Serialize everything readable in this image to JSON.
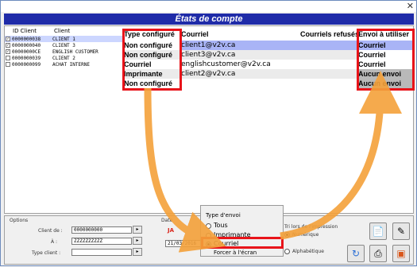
{
  "window": {
    "close_glyph": "✕",
    "title": "États de compte"
  },
  "client_list": {
    "columns": [
      "ID Client",
      "Client"
    ],
    "rows": [
      {
        "checked": true,
        "id": "0000000038",
        "name": "CLIENT 1",
        "selected": true
      },
      {
        "checked": true,
        "id": "0000000040",
        "name": "CLIENT 3",
        "selected": false
      },
      {
        "checked": true,
        "id": "00000000CE",
        "name": "ENGLISH CUSTOMER",
        "selected": false
      },
      {
        "checked": false,
        "id": "0000000039",
        "name": "CLIENT 2",
        "selected": false
      },
      {
        "checked": false,
        "id": "0000000099",
        "name": "ACHAT INTERNE",
        "selected": false
      }
    ]
  },
  "send_grid": {
    "headers": {
      "type": "Type configuré",
      "email": "Courriel",
      "refused": "Courriels refusés",
      "send": "Envoi à utiliser"
    },
    "rows": [
      {
        "type": "Non configuré",
        "email": "client1@v2v.ca",
        "send": "Courriel"
      },
      {
        "type": "Non configuré",
        "email": "client3@v2v.ca",
        "send": "Courriel"
      },
      {
        "type": "Courriel",
        "email": "englishcustomer@v2v.ca",
        "send": "Courriel"
      },
      {
        "type": "Imprimante",
        "email": "client2@v2v.ca",
        "send": "Aucun envoi"
      },
      {
        "type": "Non configuré",
        "email": "",
        "send": "Aucun envoi"
      }
    ]
  },
  "options": {
    "group_label": "Options",
    "client_from_label": "Client de :",
    "client_from_value": "0000000000",
    "client_to_label": "À :",
    "client_to_value": "ZZZZZZZZZZ",
    "client_type_label": "Type client :",
    "client_type_value": ""
  },
  "date": {
    "label": "Date",
    "value": "21/03/2016"
  },
  "send_type": {
    "title": "Type d'envoi",
    "options": [
      "Tous",
      "Imprimante",
      "Courriel"
    ],
    "selected": "Courriel",
    "force_label": "Forcer à l'écran"
  },
  "sort": {
    "title": "Tri lors de l'impression",
    "numeric": "Numérique",
    "alpha": "Alphabétique"
  },
  "colors": {
    "banner": "#1f2ba8",
    "highlight": "#e8141a",
    "arrow": "#f4a13a",
    "selected_row": "#ccd6ff"
  }
}
